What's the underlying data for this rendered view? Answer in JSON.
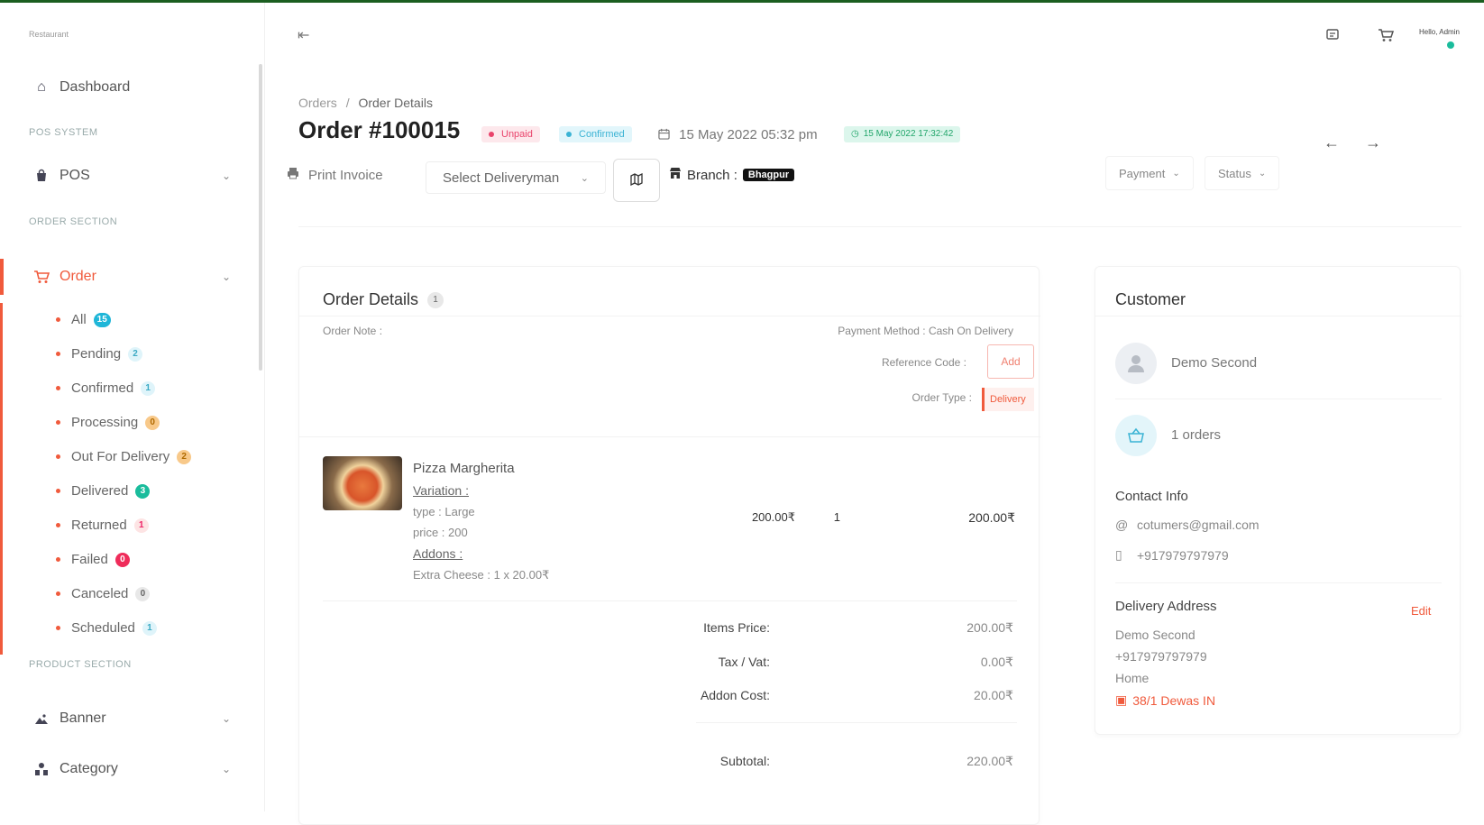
{
  "sidebar": {
    "logo": "Restaurant",
    "dashboard": "Dashboard",
    "pos_section": "POS SYSTEM",
    "pos": "POS",
    "order_section": "ORDER SECTION",
    "order": "Order",
    "order_items": [
      {
        "label": "All",
        "count": "15"
      },
      {
        "label": "Pending",
        "count": "2"
      },
      {
        "label": "Confirmed",
        "count": "1"
      },
      {
        "label": "Processing",
        "count": "0"
      },
      {
        "label": "Out For Delivery",
        "count": "2"
      },
      {
        "label": "Delivered",
        "count": "3"
      },
      {
        "label": "Returned",
        "count": "1"
      },
      {
        "label": "Failed",
        "count": "0"
      },
      {
        "label": "Canceled",
        "count": "0"
      },
      {
        "label": "Scheduled",
        "count": "1"
      }
    ],
    "product_section": "PRODUCT SECTION",
    "banner": "Banner",
    "category": "Category"
  },
  "header": {
    "user_name": "Hello, Admin"
  },
  "breadcrumb": {
    "parent": "Orders",
    "separator": "/",
    "current": "Order Details"
  },
  "order": {
    "title": "Order #100015",
    "payment_status": "Unpaid",
    "order_status": "Confirmed",
    "date": "15 May 2022 05:32 pm",
    "scheduled": "15 May 2022 17:32:42"
  },
  "toolbar": {
    "print_invoice": "Print Invoice",
    "select_deliveryman": "Select Deliveryman",
    "branch_label": "Branch :",
    "branch_value": "Bhagpur",
    "payment_filter": "Payment",
    "status_filter": "Status"
  },
  "order_details": {
    "title": "Order Details",
    "count": "1",
    "order_note": "Order Note :",
    "payment_method": "Payment Method : Cash On Delivery",
    "reference_code_label": "Reference Code :",
    "reference_add": "Add",
    "order_type_label": "Order Type :",
    "order_type_value": "Delivery",
    "item": {
      "name": "Pizza Margherita",
      "variation_label": "Variation :",
      "type": "type : Large",
      "price": "price : 200",
      "addons_label": "Addons :",
      "addon": "Extra Cheese : 1 x 20.00₹",
      "unit_price": "200.00₹",
      "qty": "1",
      "total": "200.00₹"
    },
    "summary": [
      {
        "label": "Items Price:",
        "value": "200.00₹"
      },
      {
        "label": "Tax / Vat:",
        "value": "0.00₹"
      },
      {
        "label": "Addon Cost:",
        "value": "20.00₹"
      },
      {
        "label": "Subtotal:",
        "value": "220.00₹"
      }
    ]
  },
  "customer": {
    "title": "Customer",
    "name": "Demo Second",
    "orders": "1 orders",
    "contact_title": "Contact Info",
    "email": "cotumers@gmail.com",
    "phone": "+917979797979",
    "delivery_title": "Delivery Address",
    "edit": "Edit",
    "addr_name": "Demo Second",
    "addr_phone": "+917979797979",
    "addr_type": "Home",
    "addr_location": "38/1 Dewas IN"
  },
  "colors": {
    "accent": "#f05a3c",
    "top_bar": "#1b5e20"
  }
}
